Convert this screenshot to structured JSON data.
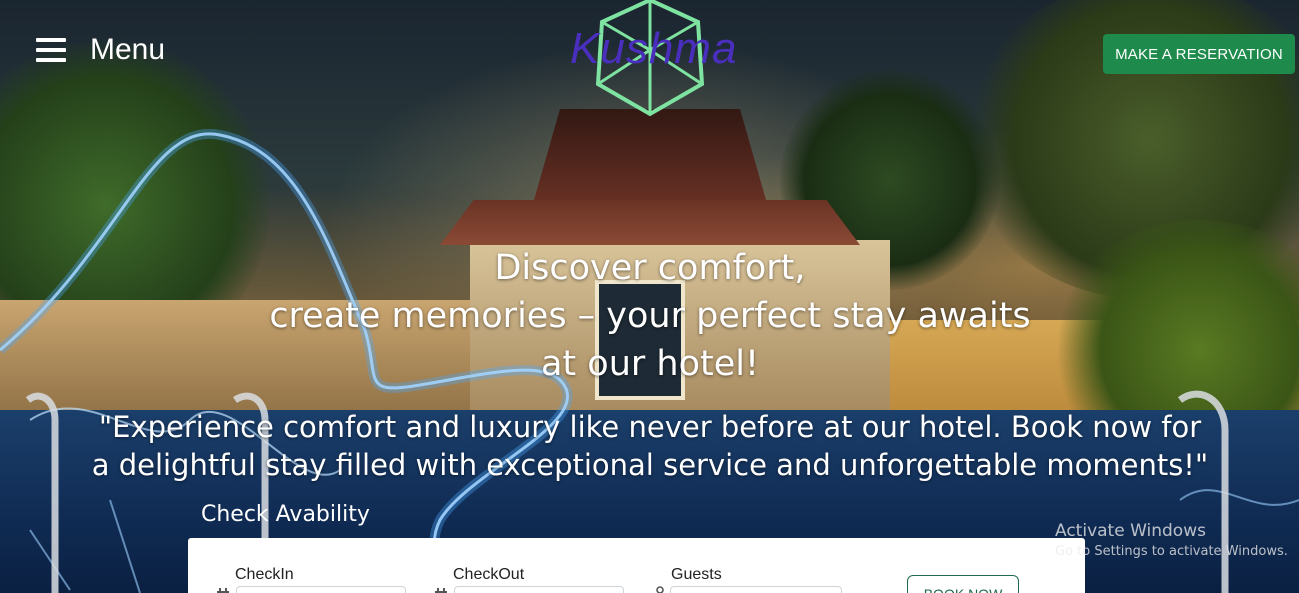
{
  "header": {
    "menu_label": "Menu",
    "logo_text": "Kushma",
    "reserve_label": "MAKE A RESERVATION"
  },
  "hero": {
    "headline_lines": [
      "Discover comfort,",
      "create memories – your perfect stay awaits",
      "at our hotel!"
    ],
    "subtitle_lines": [
      "\"Experience comfort and luxury like never before at our hotel. Book now for",
      "a delightful stay filled with exceptional service and unforgettable moments!\""
    ]
  },
  "booking": {
    "title": "Check Avability",
    "checkin_label": "CheckIn",
    "checkout_label": "CheckOut",
    "guests_label": "Guests",
    "book_label": "BOOK NOW"
  },
  "watermark": {
    "title": "Activate Windows",
    "subtitle": "Go to Settings to activate Windows."
  },
  "colors": {
    "reserve_button": "#1e8a4c",
    "logo_text": "#4a2fbf",
    "logo_gem": "#7ee2a0",
    "book_button_border": "#1e6a4a"
  },
  "icons": {
    "menu": "hamburger-icon",
    "checkin": "calendar-icon",
    "checkout": "calendar-icon",
    "guests": "person-icon"
  }
}
